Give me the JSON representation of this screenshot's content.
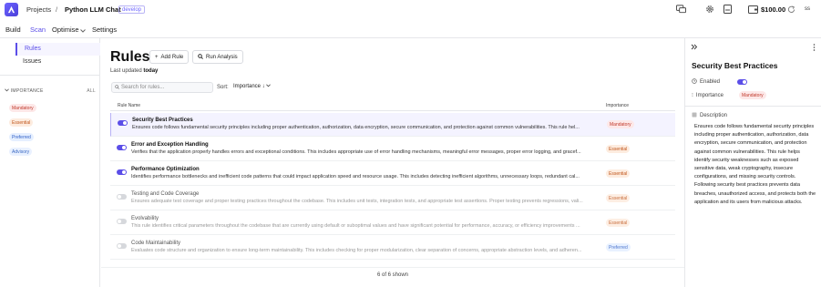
{
  "topbar": {
    "logo_icon": "app-logo-icon",
    "breadcrumb_projects": "Projects",
    "breadcrumb_sep": "/",
    "project_name": "Python LLM Chat",
    "branch": "develop",
    "credit": "$100.00",
    "user_initials": "ss"
  },
  "navtabs": {
    "build": "Build",
    "scan": "Scan",
    "optimise": "Optimise",
    "settings": "Settings"
  },
  "sidebar": {
    "nav": [
      "Rules",
      "Issues"
    ],
    "filter_heading": "IMPORTANCE",
    "filter_all": "ALL",
    "importance_tags": [
      "Mandatory",
      "Essential",
      "Preferred",
      "Advisory"
    ]
  },
  "main": {
    "title": "Rules",
    "add_rule": "Add Rule",
    "run_analysis": "Run Analysis",
    "last_updated_label": "Last updated",
    "last_updated_value": "today",
    "search_placeholder": "Search for rules...",
    "sort_label": "Sort:",
    "sort_value": "Importance ↓",
    "col_rule_name": "Rule Name",
    "col_importance": "Importance",
    "rules": [
      {
        "name": "Security Best Practices",
        "desc": "Ensures code follows fundamental security principles including proper authentication, authorization, data encryption, secure communication, and protection against common vulnerabilities. This rule hel...",
        "importance": "Mandatory",
        "enabled": true
      },
      {
        "name": "Error and Exception Handling",
        "desc": "Verifies that the application properly handles errors and exceptional conditions. This includes appropriate use of error handling mechanisms, meaningful error messages, proper error logging, and gracef...",
        "importance": "Essential",
        "enabled": true
      },
      {
        "name": "Performance Optimization",
        "desc": "Identifies performance bottlenecks and inefficient code patterns that could impact application speed and resource usage. This includes detecting inefficient algorithms, unnecessary loops, redundant cal...",
        "importance": "Essential",
        "enabled": true
      },
      {
        "name": "Testing and Code Coverage",
        "desc": "Ensures adequate test coverage and proper testing practices throughout the codebase. This includes unit tests, integration tests, and appropriate test assertions. Proper testing prevents regressions, vali...",
        "importance": "Essential",
        "enabled": false
      },
      {
        "name": "Evolvability",
        "desc": "This rule identifies critical parameters throughout the codebase that are currently using default or suboptimal values and have significant potential for performance, accuracy, or efficiency improvements ...",
        "importance": "Essential",
        "enabled": false
      },
      {
        "name": "Code Maintainability",
        "desc": "Evaluates code structure and organization to ensure long-term maintainability. This includes checking for proper modularization, clear separation of concerns, appropriate abstraction levels, and adheren...",
        "importance": "Preferred",
        "enabled": false
      }
    ],
    "shown": "6 of 6 shown"
  },
  "detail": {
    "title": "Security Best Practices",
    "enabled_label": "Enabled",
    "importance_label": "Importance",
    "importance_value": "Mandatory",
    "description_label": "Description",
    "description": "Ensures code follows fundamental security principles including proper authentication, authorization, data encryption, secure communication, and protection against common vulnerabilities. This rule helps identify security weaknesses such as exposed sensitive data, weak cryptography, insecure configurations, and missing security controls. Following security best practices prevents data breaches, unauthorized access, and protects both the application and its users from malicious attacks."
  },
  "colors": {
    "accent": "#5b4ee8",
    "mandatory": "#c0392b",
    "essential": "#c0561d",
    "preferred": "#2f5fc7"
  }
}
